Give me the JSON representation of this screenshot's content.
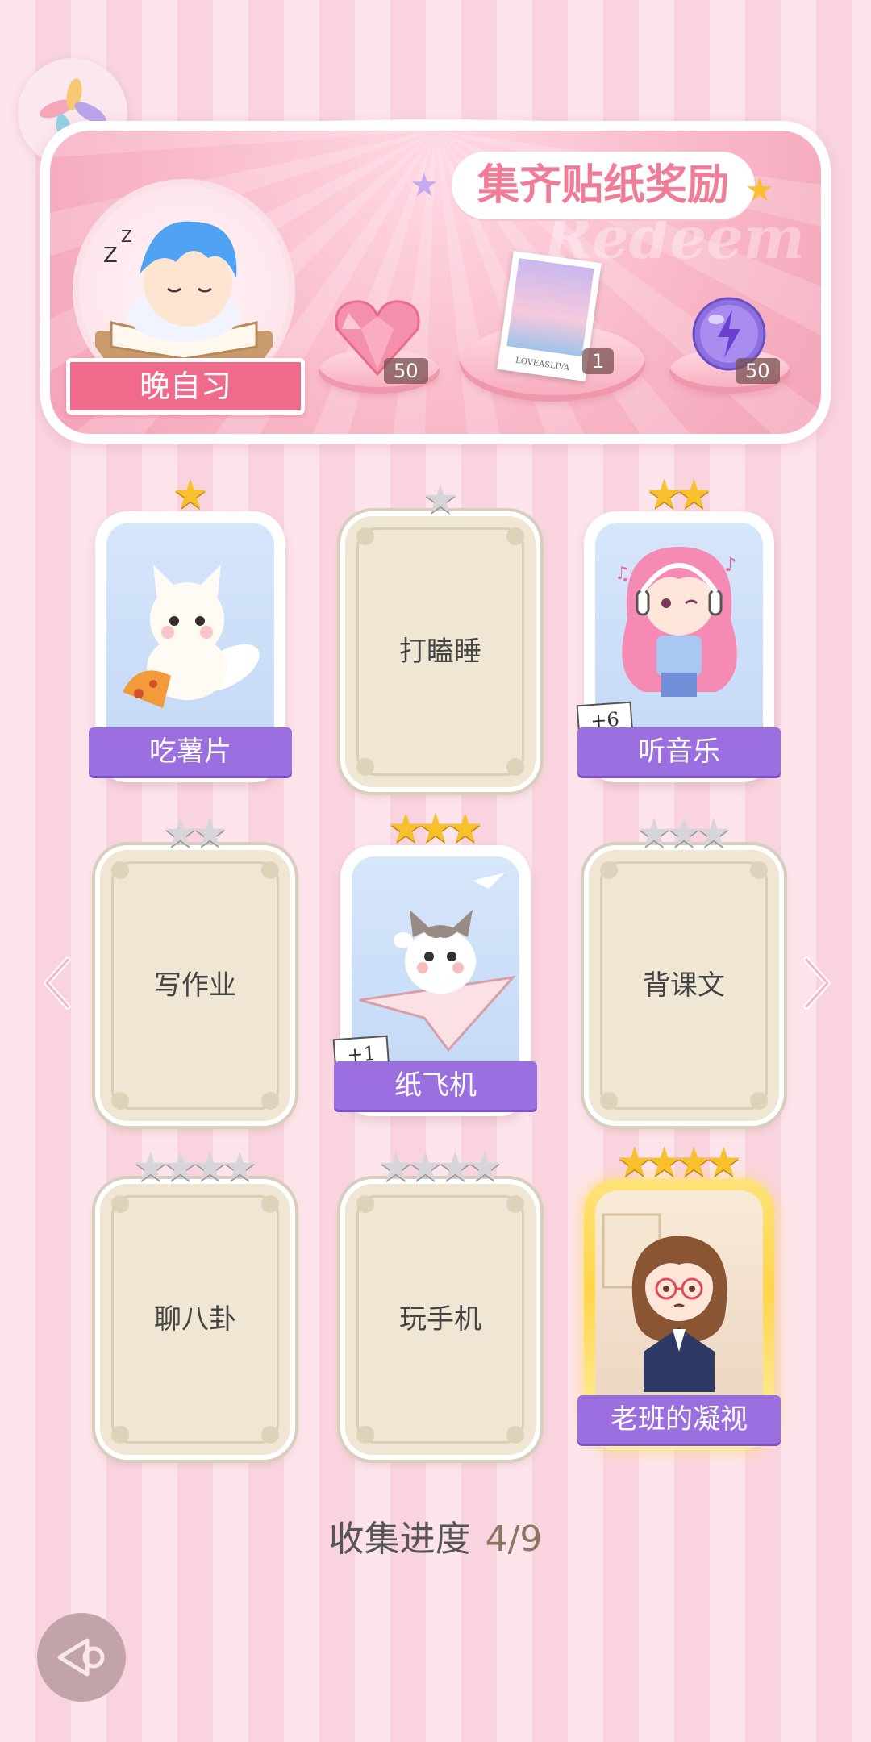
{
  "banner": {
    "title": "集齐贴纸奖励",
    "watermark": "Redeem",
    "event_name": "晚自习",
    "rewards": [
      {
        "icon": "pink-heart-gem-icon",
        "count": "50"
      },
      {
        "icon": "photo-card-icon",
        "photo_caption": "LOVEASLIVA",
        "count": "1"
      },
      {
        "icon": "purple-energy-orb-icon",
        "count": "50"
      }
    ]
  },
  "cards": [
    {
      "label": "吃薯片",
      "stars": 1,
      "collected": true,
      "plus": ""
    },
    {
      "label": "打瞌睡",
      "stars": 1,
      "collected": false,
      "plus": ""
    },
    {
      "label": "听音乐",
      "stars": 2,
      "collected": true,
      "plus": "+6"
    },
    {
      "label": "写作业",
      "stars": 2,
      "collected": false,
      "plus": ""
    },
    {
      "label": "纸飞机",
      "stars": 3,
      "collected": true,
      "plus": "+1"
    },
    {
      "label": "背课文",
      "stars": 3,
      "collected": false,
      "plus": ""
    },
    {
      "label": "聊八卦",
      "stars": 4,
      "collected": false,
      "plus": ""
    },
    {
      "label": "玩手机",
      "stars": 4,
      "collected": false,
      "plus": ""
    },
    {
      "label": "老班的凝视",
      "stars": 4,
      "collected": true,
      "plus": ""
    }
  ],
  "progress": {
    "label": "收集进度",
    "value": "4/9"
  },
  "colors": {
    "accent_pink": "#f06a8c",
    "label_purple": "#9b6fe0",
    "star_gold": "#f8c12c",
    "star_silver": "#d7d5d9"
  }
}
